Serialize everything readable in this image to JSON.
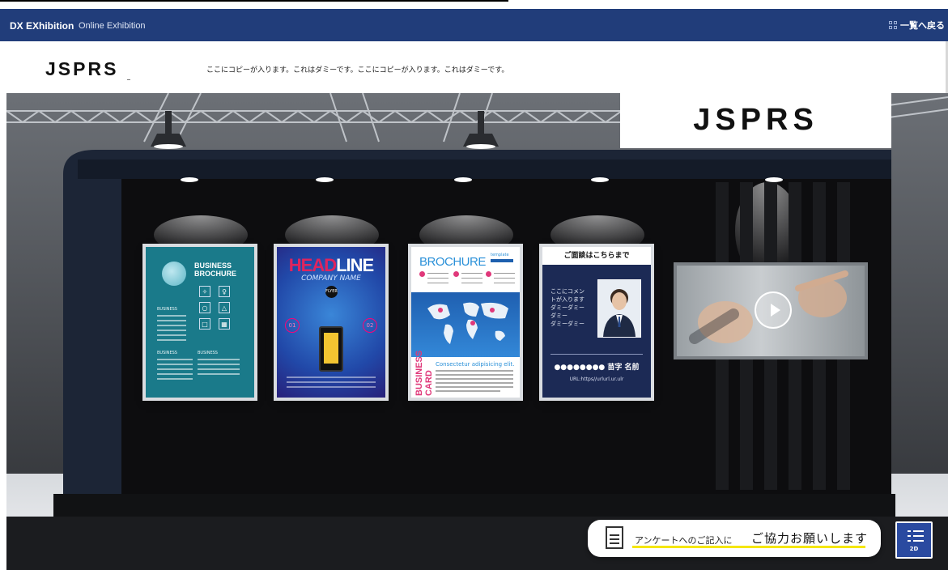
{
  "header": {
    "brand": "DX EXhibition",
    "brand_sub": "Online Exhibition",
    "back_label": "一覧へ戻る"
  },
  "subbar": {
    "logo": "JSPRS",
    "copy": "ここにコピーが入ります。これはダミーです。ここにコピーが入ります。これはダミーです。"
  },
  "booth": {
    "sign": "JSPRS",
    "panels": {
      "brochure": {
        "title1": "BUSINESS",
        "title2": "BROCHURE",
        "label1": "BUSINESS",
        "label2": "BUSINESS",
        "label3": "BUSINESS"
      },
      "flyer": {
        "head_a": "HEAD",
        "head_b": "LINE",
        "company": "COMPANY NAME",
        "badge": "FLYER",
        "num1": "01",
        "num2": "02"
      },
      "brochure2": {
        "title": "BROCHURE",
        "template": "template",
        "side": "BUSINESS CARD",
        "tagline": "Consectetur adipisicing elit."
      },
      "contact": {
        "title": "ご面談はこちらまで",
        "comment": [
          "ここにコメン",
          "トが入ります",
          "ダミーダミー",
          "ダミー",
          "ダミーダミー"
        ],
        "name": "●●●●●●●● 苗字 名前",
        "url": "URL:https//urlurl.ur.ulr"
      }
    },
    "video": {
      "play_icon": "play-icon"
    }
  },
  "survey": {
    "small": "アンケートへのご記入に",
    "large": "ご協力お願いします"
  },
  "mode_button": {
    "label": "2D"
  }
}
